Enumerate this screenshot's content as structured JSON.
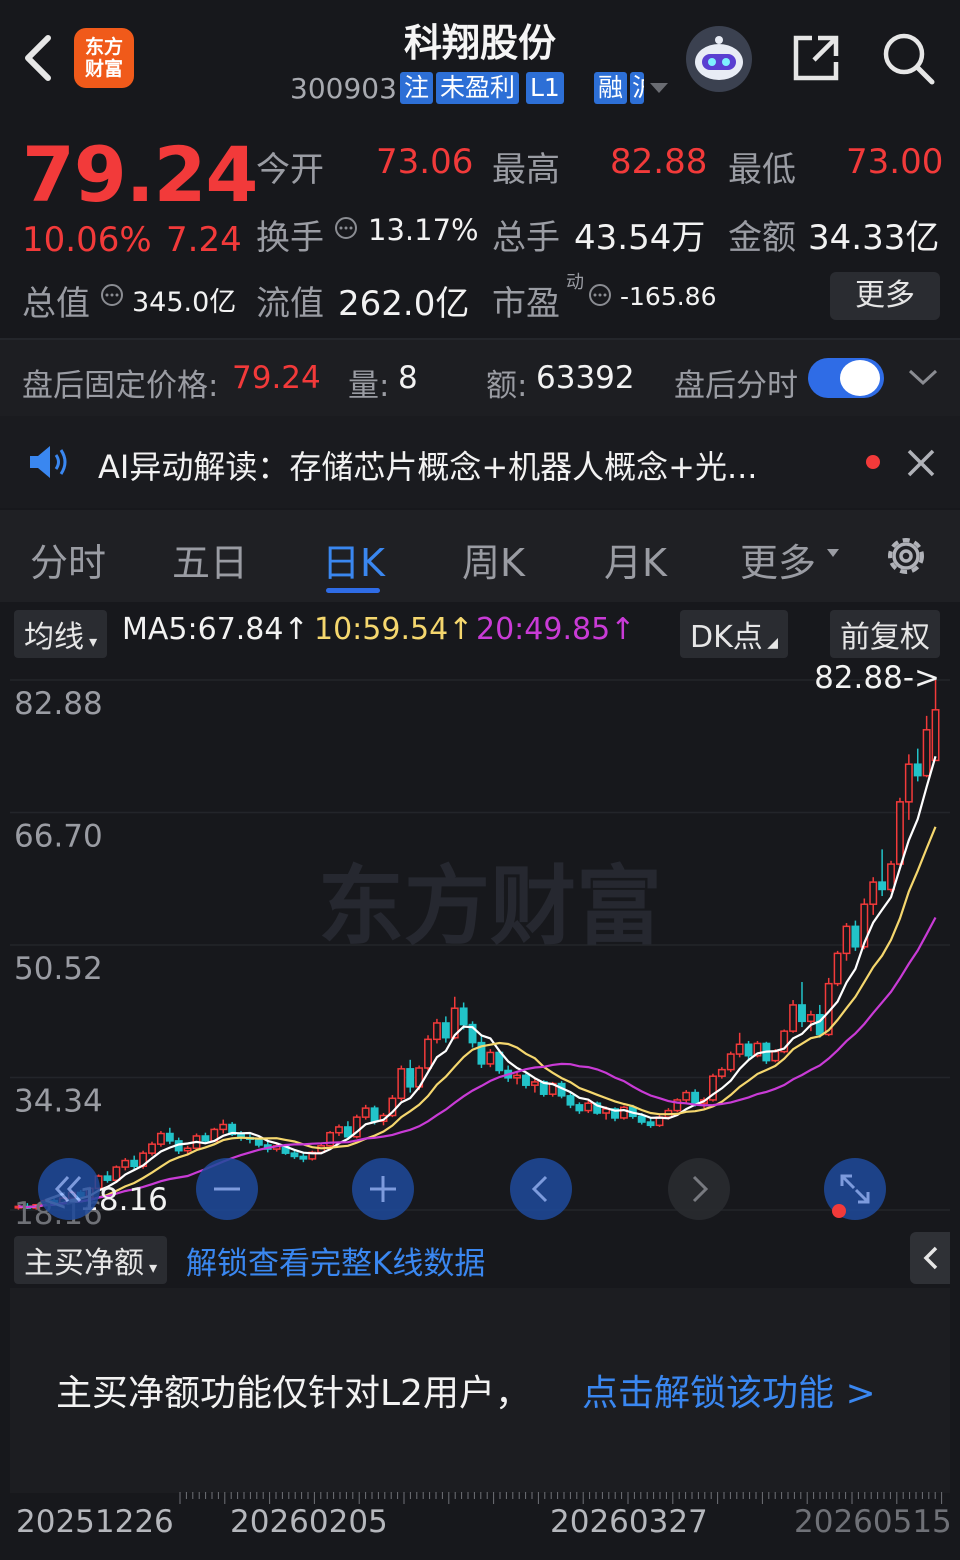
{
  "header": {
    "logo_line1": "东方",
    "logo_line2": "财富",
    "stock_name": "科翔股份",
    "stock_code": "300903",
    "tags": [
      "注",
      "未盈利",
      "L1",
      "融",
      "沪"
    ]
  },
  "quote": {
    "price": "79.24",
    "change_pct": "10.06%",
    "change": "7.24",
    "open_label": "今开",
    "open": "73.06",
    "high_label": "最高",
    "high": "82.88",
    "low_label": "最低",
    "low": "73.00",
    "turnover_label": "换手",
    "turnover": "13.17%",
    "volume_label": "总手",
    "volume": "43.54万",
    "amount_label": "金额",
    "amount": "34.33亿",
    "mktcap_label": "总值",
    "mktcap": "345.0亿",
    "float_label": "流值",
    "float": "262.0亿",
    "pe_label": "市盈",
    "pe_sup": "动",
    "pe": "-165.86",
    "more_label": "更多"
  },
  "afterhours": {
    "price_label": "盘后固定价格:",
    "price": "79.24",
    "vol_label": "量:",
    "vol": "8",
    "amt_label": "额:",
    "amt": "63392",
    "intraday_label": "盘后分时"
  },
  "ai": {
    "text": "AI异动解读：存储芯片概念+机器人概念+光..."
  },
  "tabs": {
    "items": [
      "分时",
      "五日",
      "日K",
      "周K",
      "月K",
      "更多"
    ],
    "active": "日K"
  },
  "indicator": {
    "selector": "均线",
    "ma5": "MA5:67.84",
    "ma10": "10:59.54",
    "ma20": "20:49.85",
    "dk_label": "DK点",
    "adjust_label": "前复权"
  },
  "colors": {
    "up": "#f23a3a",
    "down": "#22c3c9",
    "ma5": "#ffffff",
    "ma10": "#f5d76e",
    "ma20": "#c93bd6",
    "accent": "#2f6ce6"
  },
  "chart_data": {
    "type": "candlestick",
    "y_ticks": [
      "82.88",
      "66.70",
      "50.52",
      "34.34",
      "18.16"
    ],
    "ylim": [
      18.16,
      82.88
    ],
    "max_label": "82.88->",
    "min_label": "<-18.16",
    "x_labels": [
      "20251226",
      "20260205",
      "20260327",
      "20260515"
    ],
    "candles": [
      [
        18.5,
        18.8,
        18.2,
        18.6
      ],
      [
        18.6,
        19.0,
        18.3,
        18.4
      ],
      [
        18.4,
        18.9,
        18.2,
        18.8
      ],
      [
        18.8,
        19.5,
        18.6,
        19.3
      ],
      [
        19.3,
        19.6,
        18.9,
        19.0
      ],
      [
        19.0,
        19.8,
        18.8,
        19.6
      ],
      [
        19.6,
        20.5,
        19.4,
        20.3
      ],
      [
        20.3,
        20.6,
        19.5,
        19.7
      ],
      [
        19.7,
        21.0,
        19.6,
        20.8
      ],
      [
        20.8,
        22.5,
        20.6,
        22.3
      ],
      [
        22.3,
        22.9,
        21.5,
        21.8
      ],
      [
        21.8,
        23.6,
        21.5,
        23.4
      ],
      [
        23.4,
        24.5,
        23.0,
        24.2
      ],
      [
        24.2,
        24.8,
        23.1,
        23.5
      ],
      [
        23.5,
        25.4,
        23.2,
        25.1
      ],
      [
        25.1,
        26.5,
        24.8,
        26.2
      ],
      [
        26.2,
        27.8,
        25.9,
        27.5
      ],
      [
        27.5,
        28.2,
        26.2,
        26.6
      ],
      [
        26.6,
        27.0,
        25.0,
        25.4
      ],
      [
        25.4,
        26.0,
        24.8,
        25.7
      ],
      [
        25.7,
        27.5,
        25.5,
        27.2
      ],
      [
        27.2,
        27.6,
        26.3,
        26.6
      ],
      [
        26.6,
        28.2,
        26.5,
        28.0
      ],
      [
        28.0,
        29.2,
        27.5,
        28.6
      ],
      [
        28.6,
        28.9,
        27.2,
        27.4
      ],
      [
        27.4,
        27.8,
        26.6,
        27.0
      ],
      [
        27.0,
        27.4,
        26.3,
        26.8
      ],
      [
        26.8,
        27.0,
        25.8,
        26.1
      ],
      [
        26.1,
        26.5,
        25.2,
        25.6
      ],
      [
        25.6,
        26.3,
        25.3,
        26.0
      ],
      [
        26.0,
        26.2,
        24.9,
        25.1
      ],
      [
        25.1,
        25.5,
        24.4,
        24.7
      ],
      [
        24.7,
        25.2,
        24.0,
        24.4
      ],
      [
        24.4,
        25.4,
        24.2,
        25.2
      ],
      [
        25.2,
        26.3,
        25.0,
        26.0
      ],
      [
        26.0,
        27.8,
        25.8,
        27.6
      ],
      [
        27.6,
        28.6,
        27.2,
        28.3
      ],
      [
        28.3,
        29.0,
        26.8,
        27.1
      ],
      [
        27.1,
        29.8,
        26.9,
        29.5
      ],
      [
        29.5,
        31.0,
        29.2,
        30.6
      ],
      [
        30.6,
        30.9,
        28.6,
        29.0
      ],
      [
        29.0,
        30.0,
        28.5,
        29.7
      ],
      [
        29.7,
        32.2,
        29.5,
        31.8
      ],
      [
        31.8,
        35.8,
        31.5,
        35.4
      ],
      [
        35.4,
        36.5,
        32.5,
        33.2
      ],
      [
        33.2,
        35.8,
        32.8,
        35.5
      ],
      [
        35.5,
        39.5,
        35.2,
        39.0
      ],
      [
        39.0,
        41.5,
        38.5,
        41.0
      ],
      [
        41.0,
        41.8,
        38.6,
        39.2
      ],
      [
        39.2,
        44.2,
        39.0,
        42.8
      ],
      [
        42.8,
        43.5,
        40.2,
        40.8
      ],
      [
        40.8,
        41.2,
        38.0,
        38.6
      ],
      [
        38.6,
        39.5,
        35.5,
        36.0
      ],
      [
        36.0,
        37.8,
        35.6,
        37.4
      ],
      [
        37.4,
        37.7,
        34.8,
        35.2
      ],
      [
        35.2,
        35.8,
        33.8,
        34.3
      ],
      [
        34.3,
        35.1,
        33.5,
        34.6
      ],
      [
        34.6,
        34.9,
        33.0,
        33.4
      ],
      [
        33.4,
        34.2,
        32.5,
        33.8
      ],
      [
        33.8,
        34.0,
        32.0,
        32.3
      ],
      [
        32.3,
        33.8,
        32.0,
        33.6
      ],
      [
        33.6,
        33.9,
        31.8,
        32.1
      ],
      [
        32.1,
        32.5,
        30.6,
        31.0
      ],
      [
        31.0,
        31.3,
        29.9,
        30.3
      ],
      [
        30.3,
        31.5,
        30.0,
        31.2
      ],
      [
        31.2,
        31.4,
        29.8,
        30.0
      ],
      [
        30.0,
        30.8,
        29.2,
        30.5
      ],
      [
        30.5,
        30.7,
        29.0,
        29.4
      ],
      [
        29.4,
        30.9,
        29.2,
        30.7
      ],
      [
        30.7,
        31.0,
        29.3,
        29.6
      ],
      [
        29.6,
        30.0,
        28.6,
        28.9
      ],
      [
        28.9,
        29.4,
        28.2,
        28.5
      ],
      [
        28.5,
        29.8,
        28.3,
        29.5
      ],
      [
        29.5,
        30.6,
        29.2,
        30.3
      ],
      [
        30.3,
        31.8,
        30.1,
        31.6
      ],
      [
        31.6,
        32.8,
        31.3,
        32.5
      ],
      [
        32.5,
        32.9,
        30.8,
        31.2
      ],
      [
        31.2,
        31.9,
        30.6,
        31.6
      ],
      [
        31.6,
        34.8,
        31.4,
        34.5
      ],
      [
        34.5,
        35.6,
        34.2,
        35.3
      ],
      [
        35.3,
        37.5,
        35.0,
        37.2
      ],
      [
        37.2,
        39.8,
        36.8,
        38.4
      ],
      [
        38.4,
        38.8,
        36.6,
        37.0
      ],
      [
        37.0,
        38.8,
        36.8,
        38.5
      ],
      [
        38.5,
        38.7,
        36.0,
        36.4
      ],
      [
        36.4,
        37.8,
        36.2,
        37.5
      ],
      [
        37.5,
        40.2,
        37.3,
        40.0
      ],
      [
        40.0,
        43.8,
        39.8,
        43.2
      ],
      [
        43.2,
        46.0,
        40.5,
        41.2
      ],
      [
        41.2,
        42.5,
        40.0,
        42.0
      ],
      [
        42.0,
        43.2,
        39.2,
        39.6
      ],
      [
        39.6,
        46.5,
        39.4,
        45.8
      ],
      [
        45.8,
        49.8,
        45.5,
        49.5
      ],
      [
        49.5,
        53.2,
        48.6,
        52.8
      ],
      [
        52.8,
        53.5,
        49.8,
        50.3
      ],
      [
        50.3,
        56.2,
        50.0,
        55.5
      ],
      [
        55.5,
        58.8,
        54.2,
        58.2
      ],
      [
        58.2,
        62.2,
        56.5,
        57.3
      ],
      [
        57.3,
        60.8,
        57.0,
        60.4
      ],
      [
        60.4,
        68.5,
        60.2,
        68.0
      ],
      [
        68.0,
        73.8,
        65.8,
        72.6
      ],
      [
        72.6,
        74.5,
        70.5,
        71.2
      ],
      [
        71.2,
        78.5,
        71.0,
        76.8
      ],
      [
        73.06,
        82.88,
        73.0,
        79.24
      ]
    ],
    "ma5_end": "67.84",
    "ma10_end": "59.54",
    "ma20_end": "49.85"
  },
  "panel": {
    "selector": "主买净额",
    "unlock_text": "解锁查看完整K线数据",
    "notice": "主买净额功能仅针对L2用户，",
    "notice_link": "点击解锁该功能 >"
  },
  "watermark": "东方财富"
}
